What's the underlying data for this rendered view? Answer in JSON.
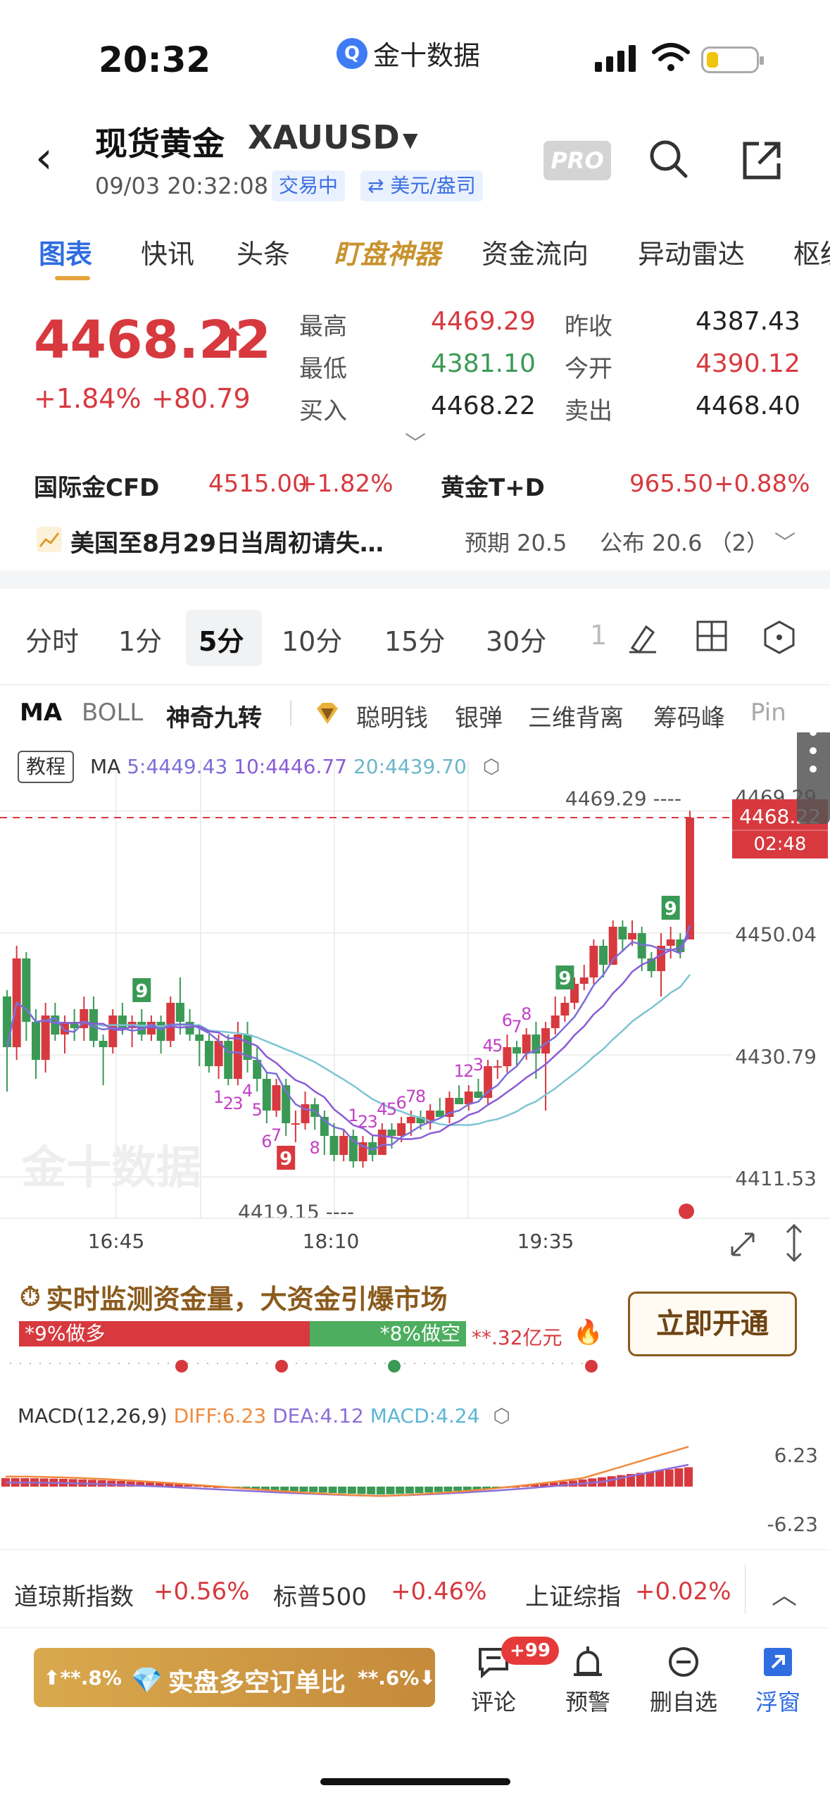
{
  "status_bar": {
    "time": "20:32",
    "app_name": "金十数据"
  },
  "header": {
    "title": "现货黄金",
    "symbol": "XAUUSD",
    "datetime": "09/03 20:32:08",
    "status_chip": "交易中",
    "unit_chip": "⇄ 美元/盎司",
    "pro_label": "PRO"
  },
  "tabs": [
    "图表",
    "快讯",
    "头条",
    "盯盘神器",
    "资金流向",
    "异动雷达",
    "枢纽"
  ],
  "quote": {
    "price": "4468.22",
    "change_pct": "+1.84%",
    "change": "+80.79",
    "stats": [
      {
        "label": "最高",
        "value": "4469.29",
        "color": "red"
      },
      {
        "label": "昨收",
        "value": "4387.43",
        "color": "dark"
      },
      {
        "label": "最低",
        "value": "4381.10",
        "color": "green"
      },
      {
        "label": "今开",
        "value": "4390.12",
        "color": "red"
      },
      {
        "label": "买入",
        "value": "4468.22",
        "color": "dark"
      },
      {
        "label": "卖出",
        "value": "4468.40",
        "color": "dark"
      }
    ]
  },
  "cross_quotes": [
    {
      "name": "国际金CFD",
      "price": "4515.00",
      "pct": "+1.82%"
    },
    {
      "name": "黄金T+D",
      "price": "965.50",
      "pct": "+0.88%"
    }
  ],
  "event": {
    "title": "美国至8月29日当周初请失…",
    "expected": "预期 20.5",
    "published": "公布 20.6 （2）"
  },
  "periods": [
    "分时",
    "1分",
    "5分",
    "10分",
    "15分",
    "30分",
    "1"
  ],
  "indicators": [
    "MA",
    "BOLL",
    "神奇九转",
    "聪明钱",
    "银弹",
    "三维背离",
    "筹码峰",
    "Pin"
  ],
  "chart": {
    "tutorial": "教程",
    "ma_label": "MA",
    "ma5": "5:4449.43",
    "ma10": "10:4446.77",
    "ma20": "20:4439.70",
    "y_ticks": [
      "4469.29",
      "4450.04",
      "4430.79",
      "4411.53"
    ],
    "x_ticks": [
      "16:45",
      "18:10",
      "19:35"
    ],
    "high_annotation": "4469.29 ----",
    "low_annotation": "4419.15 ----",
    "current_price": "4468.22",
    "countdown": "02:48",
    "watermark": "金十数据",
    "colors": {
      "up": "#d7393f",
      "down": "#3a9a55",
      "ma5": "#7b6fd8",
      "ma10": "#8a5bd6",
      "ma20": "#7ec4d4",
      "seq_up": "#c23fc6"
    }
  },
  "chart_data": {
    "type": "candlestick",
    "y_range": [
      4405,
      4475
    ],
    "x_ticks": [
      "16:45",
      "18:10",
      "19:35"
    ],
    "candles": [
      [
        4440,
        4441,
        4425,
        4432
      ],
      [
        4432,
        4448,
        4430,
        4446
      ],
      [
        4446,
        4447,
        4433,
        4436
      ],
      [
        4436,
        4438,
        4427,
        4430
      ],
      [
        4430,
        4439,
        4428,
        4437
      ],
      [
        4437,
        4439,
        4433,
        4434
      ],
      [
        4434,
        4437,
        4431,
        4436
      ],
      [
        4436,
        4438,
        4433,
        4435
      ],
      [
        4435,
        4440,
        4433,
        4438
      ],
      [
        4438,
        4440,
        4432,
        4433
      ],
      [
        4433,
        4434,
        4426,
        4432
      ],
      [
        4432,
        4438,
        4431,
        4437
      ],
      [
        4437,
        4439,
        4434,
        4435
      ],
      [
        4435,
        4437,
        4432,
        4436
      ],
      [
        4436,
        4438,
        4433,
        4434
      ],
      [
        4434,
        4437,
        4433,
        4436
      ],
      [
        4436,
        4437,
        4431,
        4433
      ],
      [
        4433,
        4440,
        4432,
        4439
      ],
      [
        4439,
        4443,
        4434,
        4436
      ],
      [
        4436,
        4438,
        4433,
        4434
      ],
      [
        4434,
        4435,
        4429,
        4433
      ],
      [
        4433,
        4434,
        4428,
        4429
      ],
      [
        4429,
        4434,
        4427,
        4433
      ],
      [
        4433,
        4434,
        4426,
        4427
      ],
      [
        4427,
        4436,
        4426,
        4434
      ],
      [
        4434,
        4436,
        4428,
        4430
      ],
      [
        4430,
        4432,
        4425,
        4427
      ],
      [
        4427,
        4428,
        4420,
        4422
      ],
      [
        4422,
        4427,
        4421,
        4426
      ],
      [
        4426,
        4427,
        4418,
        4420
      ],
      [
        4420,
        4422,
        4417,
        4420
      ],
      [
        4420,
        4425,
        4419,
        4423
      ],
      [
        4423,
        4424,
        4419,
        4421
      ],
      [
        4421,
        4422,
        4415,
        4418
      ],
      [
        4418,
        4420,
        4414,
        4415
      ],
      [
        4415,
        4419,
        4414,
        4418
      ],
      [
        4418,
        4419,
        4413,
        4414
      ],
      [
        4414,
        4418,
        4413,
        4417
      ],
      [
        4417,
        4418,
        4414,
        4415
      ],
      [
        4415,
        4420,
        4415,
        4419
      ],
      [
        4419,
        4420,
        4416,
        4418
      ],
      [
        4418,
        4421,
        4417,
        4420
      ],
      [
        4420,
        4422,
        4418,
        4421
      ],
      [
        4421,
        4422,
        4419,
        4420
      ],
      [
        4420,
        4423,
        4419,
        4422
      ],
      [
        4422,
        4424,
        4421,
        4421
      ],
      [
        4421,
        4425,
        4420,
        4424
      ],
      [
        4424,
        4426,
        4423,
        4423
      ],
      [
        4423,
        4426,
        4422,
        4425
      ],
      [
        4425,
        4427,
        4424,
        4424
      ],
      [
        4424,
        4430,
        4423,
        4429
      ],
      [
        4429,
        4430,
        4427,
        4429
      ],
      [
        4429,
        4434,
        4428,
        4432
      ],
      [
        4432,
        4433,
        4429,
        4431
      ],
      [
        4431,
        4435,
        4430,
        4434
      ],
      [
        4434,
        4436,
        4427,
        4431
      ],
      [
        4431,
        4436,
        4422,
        4435
      ],
      [
        4435,
        4440,
        4434,
        4437
      ],
      [
        4437,
        4440,
        4436,
        4439
      ],
      [
        4439,
        4443,
        4438,
        4442
      ],
      [
        4442,
        4445,
        4441,
        4443
      ],
      [
        4443,
        4449,
        4442,
        4448
      ],
      [
        4448,
        4449,
        4443,
        4445
      ],
      [
        4445,
        4452,
        4445,
        4451
      ],
      [
        4451,
        4452,
        4447,
        4449
      ],
      [
        4449,
        4452,
        4448,
        4450
      ],
      [
        4450,
        4451,
        4444,
        4446
      ],
      [
        4446,
        4447,
        4443,
        4444
      ],
      [
        4444,
        4450,
        4440,
        4448
      ],
      [
        4448,
        4451,
        4446,
        4449
      ],
      [
        4449,
        4450,
        4446,
        4447
      ],
      [
        4449,
        4469.29,
        4449,
        4468.22
      ]
    ]
  },
  "fund_monitor": {
    "title": "实时监测资金量，大资金引爆市场",
    "long_label": "*9%做多",
    "short_label": "*8%做空",
    "long_pct": 0.65,
    "amount": "**.32亿元",
    "open_button": "立即开通"
  },
  "macd": {
    "label": "MACD(12,26,9)",
    "diff": "DIFF:6.23",
    "dea": "DEA:4.12",
    "macd": "MACD:4.24",
    "y_top": "6.23",
    "y_bottom": "-6.23",
    "colors": {
      "diff": "#f08a3c",
      "dea": "#8a6fd8",
      "macd": "#5bb6d6"
    }
  },
  "tickers": [
    {
      "name": "道琼斯指数",
      "value": "+0.56%"
    },
    {
      "name": "标普500",
      "value": "+0.46%"
    },
    {
      "name": "上证综指",
      "value": "+0.02%"
    }
  ],
  "bottom_bar": {
    "ls_left": "⬆**.8%",
    "ls_title": "实盘多空订单比",
    "ls_right": "**.6%⬇",
    "badge": "+99",
    "nav": [
      "评论",
      "预警",
      "删自选",
      "浮窗"
    ]
  }
}
